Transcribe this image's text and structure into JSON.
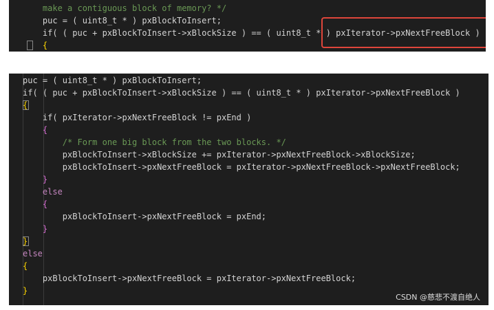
{
  "top_snippet": {
    "lines": [
      "    make a contiguous block of memory? */",
      "    puc = ( uint8_t * ) pxBlockToInsert;",
      "    if( ( puc + pxBlockToInsert->xBlockSize ) == ( uint8_t * ) pxIterator->pxNextFreeBlock )",
      "    {"
    ]
  },
  "bottom_snippet": {
    "lines": [
      "puc = ( uint8_t * ) pxBlockToInsert;",
      "if( ( puc + pxBlockToInsert->xBlockSize ) == ( uint8_t * ) pxIterator->pxNextFreeBlock )",
      "{",
      "    if( pxIterator->pxNextFreeBlock != pxEnd )",
      "    {",
      "        /* Form one big block from the two blocks. */",
      "        pxBlockToInsert->xBlockSize += pxIterator->pxNextFreeBlock->xBlockSize;",
      "        pxBlockToInsert->pxNextFreeBlock = pxIterator->pxNextFreeBlock->pxNextFreeBlock;",
      "    }",
      "    else",
      "    {",
      "        pxBlockToInsert->pxNextFreeBlock = pxEnd;",
      "    }",
      "}",
      "else",
      "{",
      "    pxBlockToInsert->pxNextFreeBlock = pxIterator->pxNextFreeBlock;",
      "}"
    ]
  },
  "annotation": {
    "color": "#e0463b"
  },
  "watermark": "CSDN @慈悲不渡自绝人"
}
